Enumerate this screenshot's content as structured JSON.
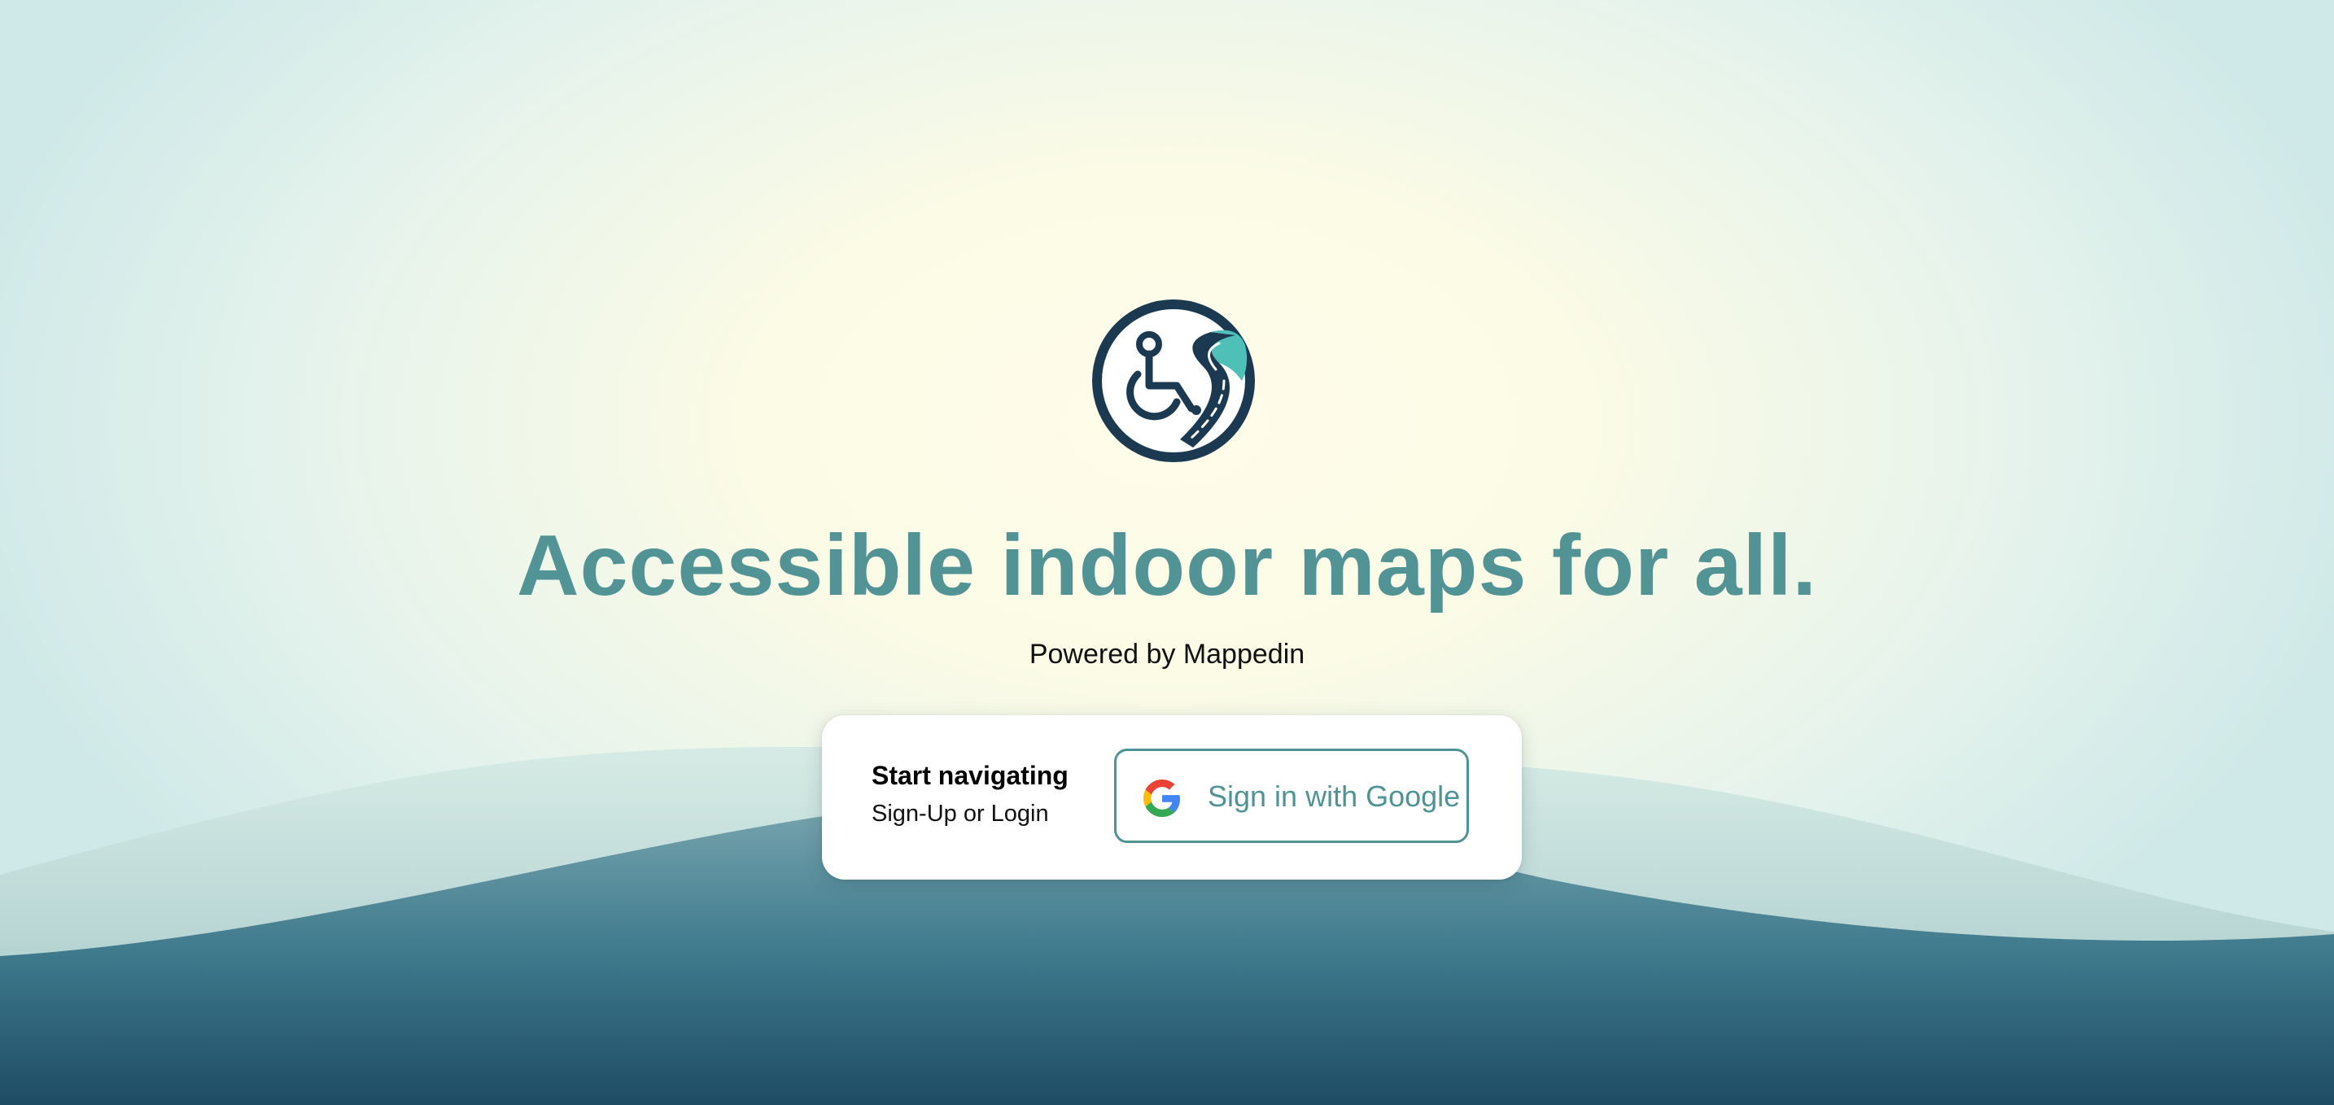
{
  "hero": {
    "logo_icon": "wheelchair-path-logo-icon",
    "headline": "Accessible indoor maps for all.",
    "powered_by": "Powered by Mappedin"
  },
  "signin_card": {
    "title": "Start navigating",
    "subtitle": "Sign-Up or Login",
    "google_button": {
      "label": "Sign in with Google",
      "icon": "google-icon"
    }
  },
  "colors": {
    "accent": "#529496",
    "logo_dark": "#1b3a52",
    "logo_accent": "#4fc0b8",
    "wave_dark": "#1e4c65"
  }
}
